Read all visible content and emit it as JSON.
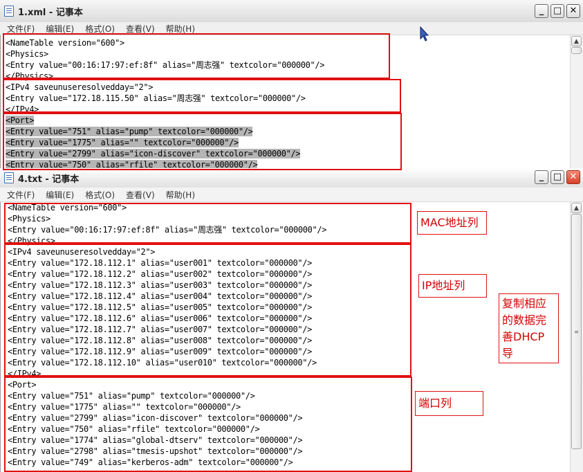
{
  "window1": {
    "title": "1.xml - 记事本",
    "menu": [
      "文件(F)",
      "编辑(E)",
      "格式(O)",
      "查看(V)",
      "帮助(H)"
    ],
    "lines": [
      "<NameTable version=\"600\">",
      "<Physics>",
      "<Entry value=\"00:16:17:97:ef:8f\" alias=\"周志强\" textcolor=\"000000\"/>",
      "</Physics>",
      "<IPv4 saveunuseresolvedday=\"2\">",
      "<Entry value=\"172.18.115.50\" alias=\"周志强\" textcolor=\"000000\"/>",
      "</IPv4>",
      "<Port>",
      "<Entry value=\"751\" alias=\"pump\" textcolor=\"000000\"/>",
      "<Entry value=\"1775\" alias=\"\" textcolor=\"000000\"/>",
      "<Entry value=\"2799\" alias=\"icon-discover\" textcolor=\"000000\"/>",
      "<Entry value=\"750\" alias=\"rfile\" textcolor=\"000000\"/>"
    ]
  },
  "window2": {
    "title": "4.txt - 记事本",
    "menu": [
      "文件(F)",
      "编辑(E)",
      "格式(O)",
      "查看(V)",
      "帮助(H)"
    ],
    "lines": [
      "<NameTable version=\"600\">",
      "<Physics>",
      "<Entry value=\"00:16:17:97:ef:8f\" alias=\"周志强\" textcolor=\"000000\"/>",
      "</Physics>",
      "<IPv4 saveunuseresolvedday=\"2\">",
      "<Entry value=\"172.18.112.1\" alias=\"user001\" textcolor=\"000000\"/>",
      "<Entry value=\"172.18.112.2\" alias=\"user002\" textcolor=\"000000\"/>",
      "<Entry value=\"172.18.112.3\" alias=\"user003\" textcolor=\"000000\"/>",
      "<Entry value=\"172.18.112.4\" alias=\"user004\" textcolor=\"000000\"/>",
      "<Entry value=\"172.18.112.5\" alias=\"user005\" textcolor=\"000000\"/>",
      "<Entry value=\"172.18.112.6\" alias=\"user006\" textcolor=\"000000\"/>",
      "<Entry value=\"172.18.112.7\" alias=\"user007\" textcolor=\"000000\"/>",
      "<Entry value=\"172.18.112.8\" alias=\"user008\" textcolor=\"000000\"/>",
      "<Entry value=\"172.18.112.9\" alias=\"user009\" textcolor=\"000000\"/>",
      "<Entry value=\"172.18.112.10\" alias=\"user010\" textcolor=\"000000\"/>",
      "</IPv4>",
      "<Port>",
      "<Entry value=\"751\" alias=\"pump\" textcolor=\"000000\"/>",
      "<Entry value=\"1775\" alias=\"\" textcolor=\"000000\"/>",
      "<Entry value=\"2799\" alias=\"icon-discover\" textcolor=\"000000\"/>",
      "<Entry value=\"750\" alias=\"rfile\" textcolor=\"000000\"/>",
      "<Entry value=\"1774\" alias=\"global-dtserv\" textcolor=\"000000\"/>",
      "<Entry value=\"2798\" alias=\"tmesis-upshot\" textcolor=\"000000\"/>",
      "<Entry value=\"749\" alias=\"kerberos-adm\" textcolor=\"000000\"/>"
    ]
  },
  "annotations": {
    "mac": "MAC地址列",
    "ip": "IP地址列",
    "port": "端口列",
    "note_lines": [
      "复制相应",
      "的数据完",
      "善DHCP导"
    ]
  },
  "controls": {
    "minimize": "_",
    "maximize": "□",
    "close": "✕"
  },
  "colors": {
    "annotation_red": "#e01010",
    "selection_gray": "#b5b5b5"
  }
}
